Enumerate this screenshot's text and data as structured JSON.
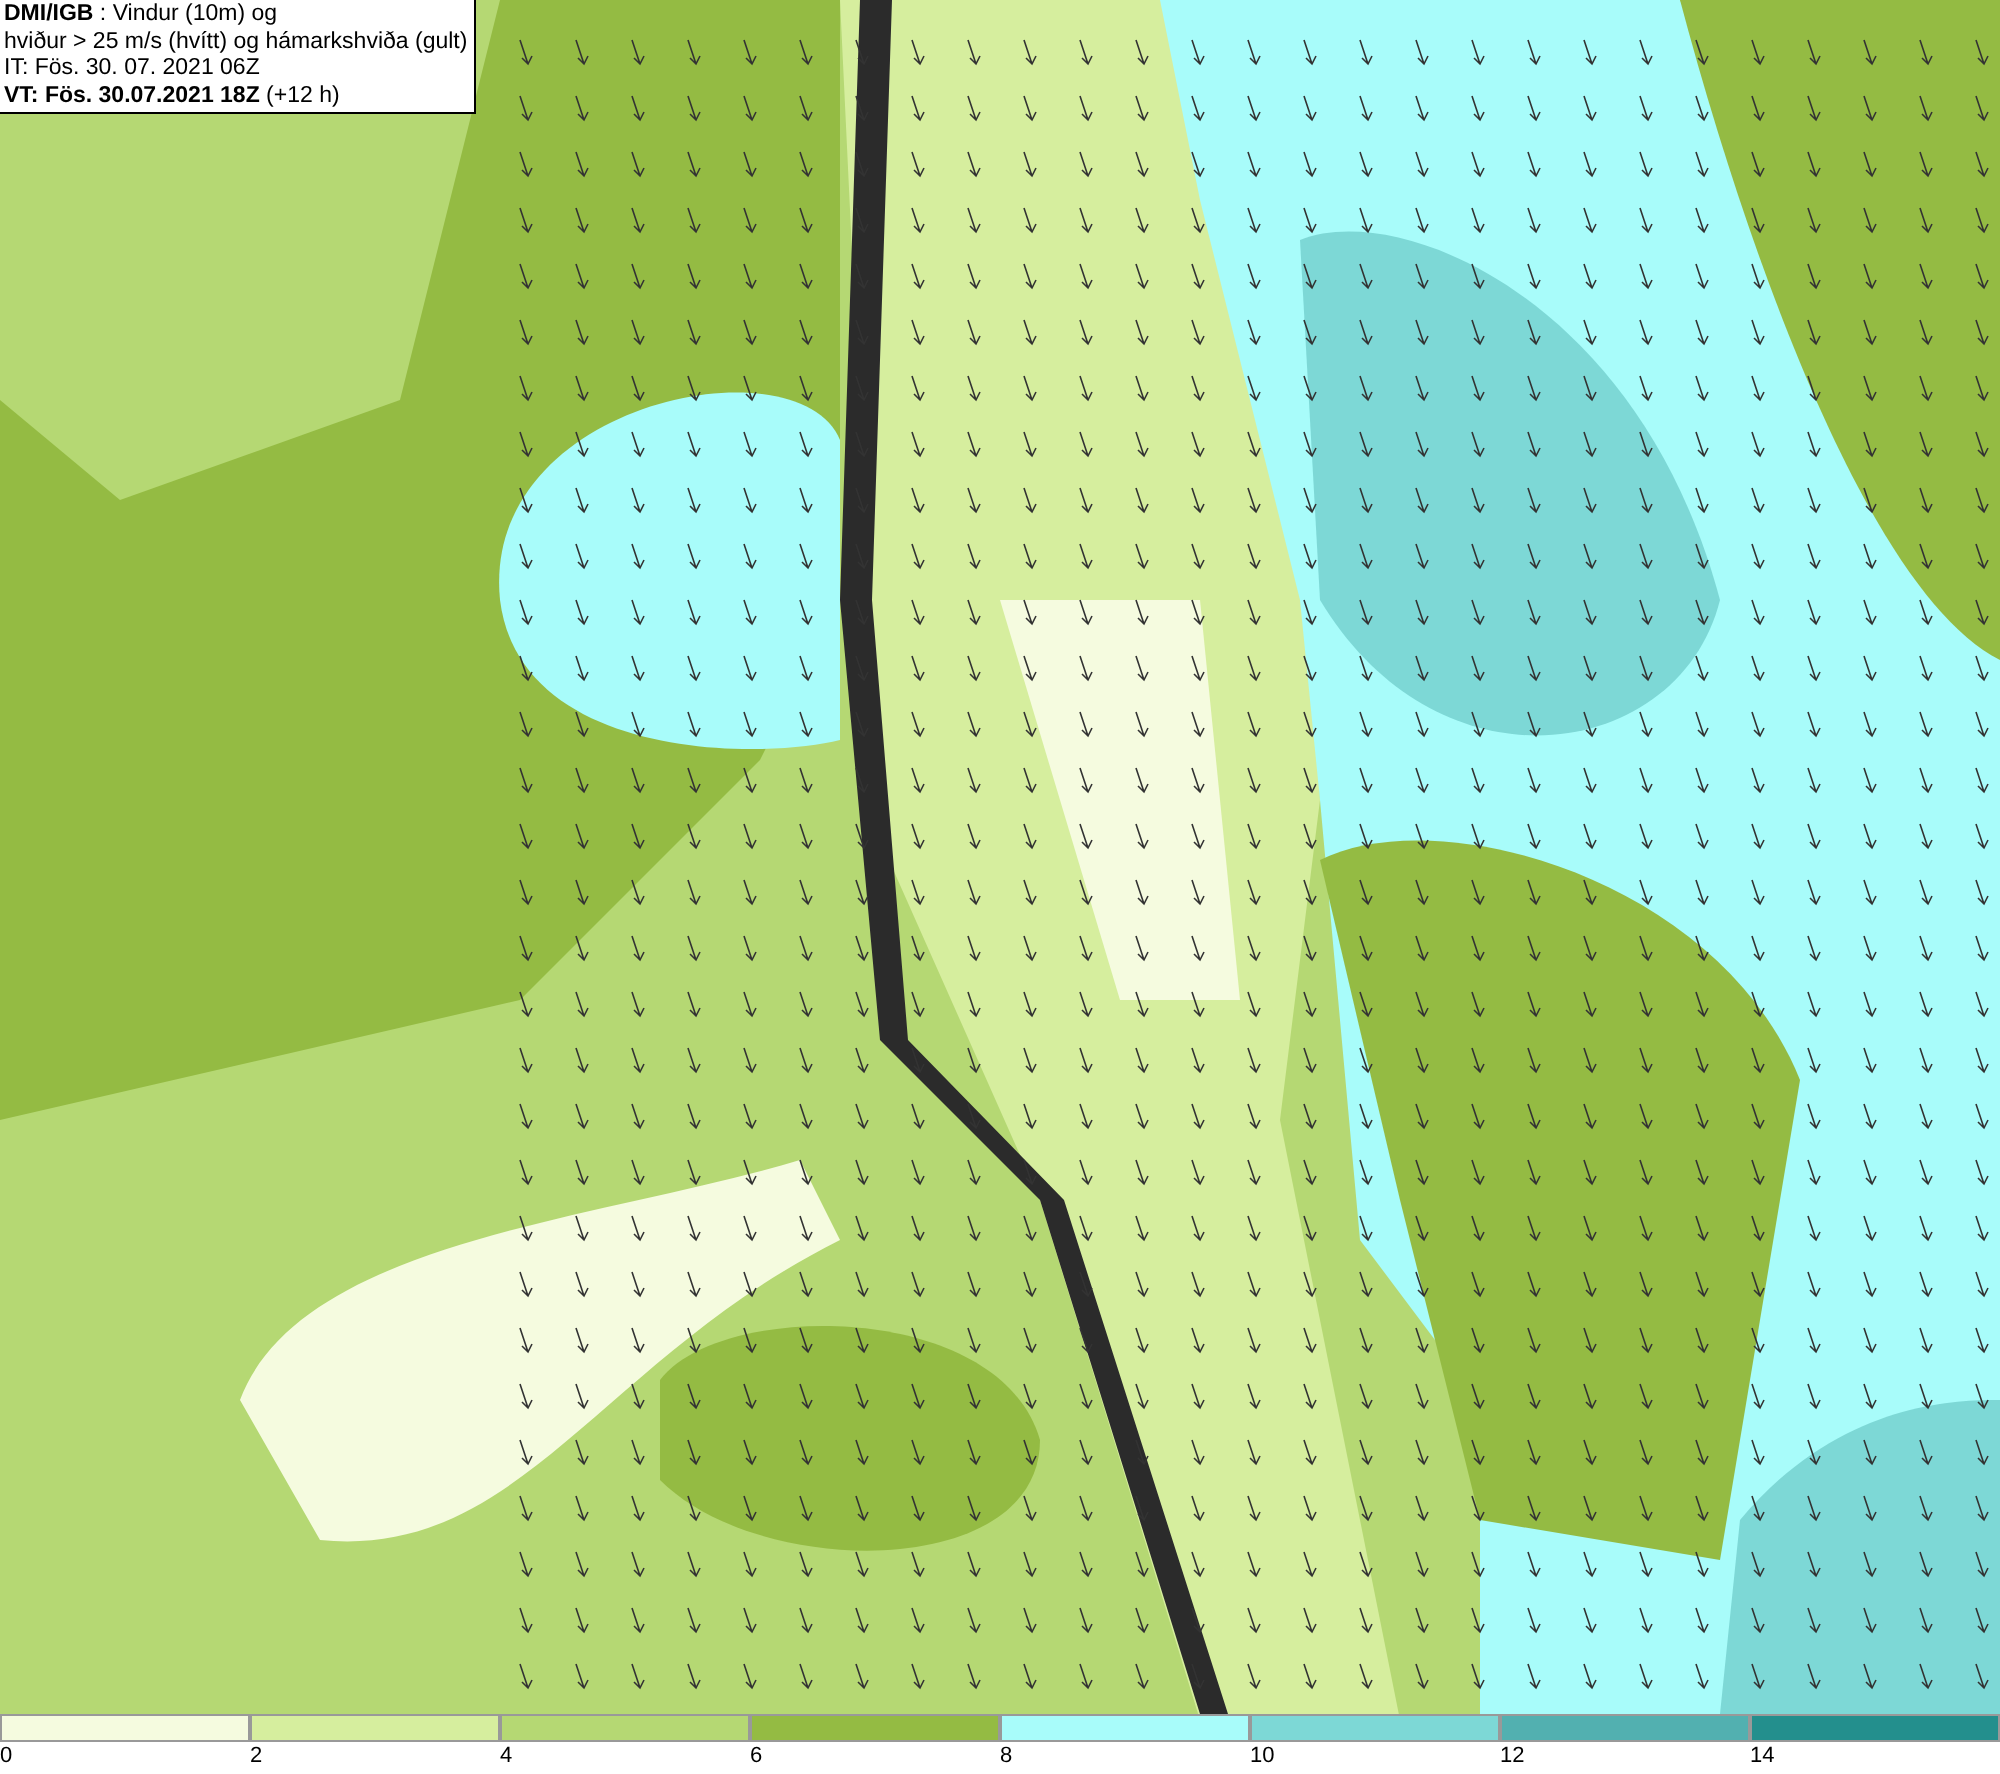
{
  "title_box": {
    "lines": [
      "**DMI/IGB** : Vindur (10m) og",
      "hviður > 25 m/s (hvítt) og hámarkshviða (gult)",
      "IT: Fös. 30. 07. 2021 06Z",
      "**VT: Fös. 30.07.2021 18Z** (+12 h)"
    ]
  },
  "legend": [
    {
      "label": "0",
      "color": "#f5fbdf"
    },
    {
      "label": "2",
      "color": "#d6ee9e"
    },
    {
      "label": "4",
      "color": "#b5d873"
    },
    {
      "label": "6",
      "color": "#94bb43"
    },
    {
      "label": "8",
      "color": "#a8fcfa"
    },
    {
      "label": "10",
      "color": "#7dd8d6"
    },
    {
      "label": "12",
      "color": "#52b0b0"
    },
    {
      "label": "14",
      "color": "#238f8d"
    }
  ]
}
